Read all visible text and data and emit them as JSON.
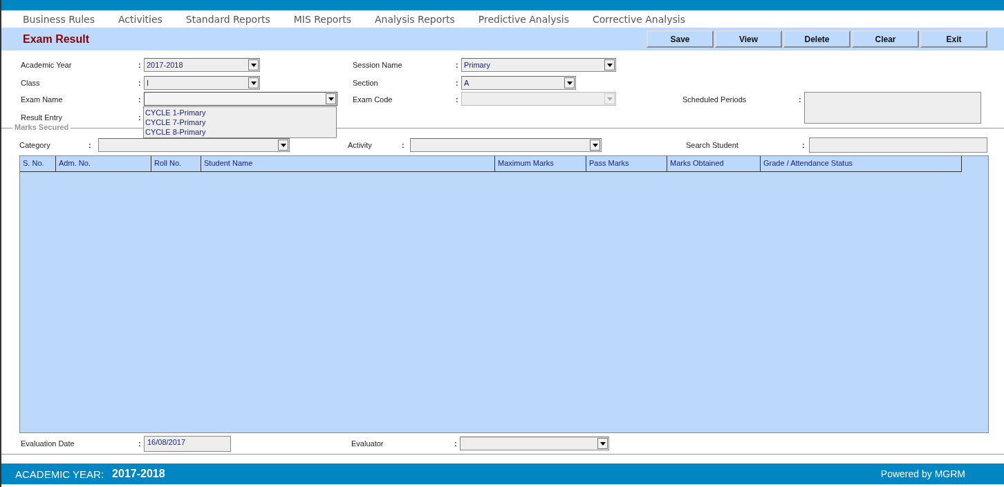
{
  "menu": [
    {
      "label": "Business Rules"
    },
    {
      "label": "Activities"
    },
    {
      "label": "Standard Reports"
    },
    {
      "label": "MIS Reports"
    },
    {
      "label": "Analysis Reports"
    },
    {
      "label": "Predictive Analysis"
    },
    {
      "label": "Corrective Analysis"
    }
  ],
  "page_title": "Exam Result",
  "buttons": [
    {
      "label": "Save"
    },
    {
      "label": "View"
    },
    {
      "label": "Delete"
    },
    {
      "label": "Clear"
    },
    {
      "label": "Exit"
    }
  ],
  "separator": ":",
  "form": {
    "academic_year": {
      "label": "Academic Year",
      "value": "2017-2018",
      "disabled": false
    },
    "session_name": {
      "label": "Session Name",
      "value": "Primary",
      "disabled": false
    },
    "class": {
      "label": "Class",
      "value": "I",
      "disabled": false
    },
    "section": {
      "label": "Section",
      "value": "A",
      "disabled": false
    },
    "exam_name": {
      "label": "Exam Name",
      "disabled": false,
      "expanded": true,
      "options": [
        "CYCLE 1-Primary",
        "CYCLE 7-Primary",
        "CYCLE 8-Primary"
      ]
    },
    "exam_code": {
      "label": "Exam Code",
      "disabled": true
    },
    "scheduled_periods": {
      "label": "Scheduled Periods"
    },
    "result_entry": {
      "label": "Result Entry"
    }
  },
  "marks_secured": {
    "legend": "Marks Secured",
    "category": {
      "label": "Category",
      "disabled": false
    },
    "activity": {
      "label": "Activity",
      "disabled": false
    },
    "search_student": {
      "label": "Search Student"
    },
    "table": {
      "columns": [
        "S. No.",
        "Adm. No.",
        "Roll No.",
        "Student Name",
        "Maximum Marks",
        "Pass Marks",
        "Marks Obtained",
        "Grade / Attendance Status"
      ]
    }
  },
  "evaluation_date": {
    "label": "Evaluation Date",
    "value": "16/08/2017"
  },
  "evaluator": {
    "label": "Evaluator",
    "disabled": false
  },
  "footer": {
    "label": "ACADEMIC YEAR:",
    "year": "2017-2018",
    "powered_by": "Powered by MGRM"
  }
}
